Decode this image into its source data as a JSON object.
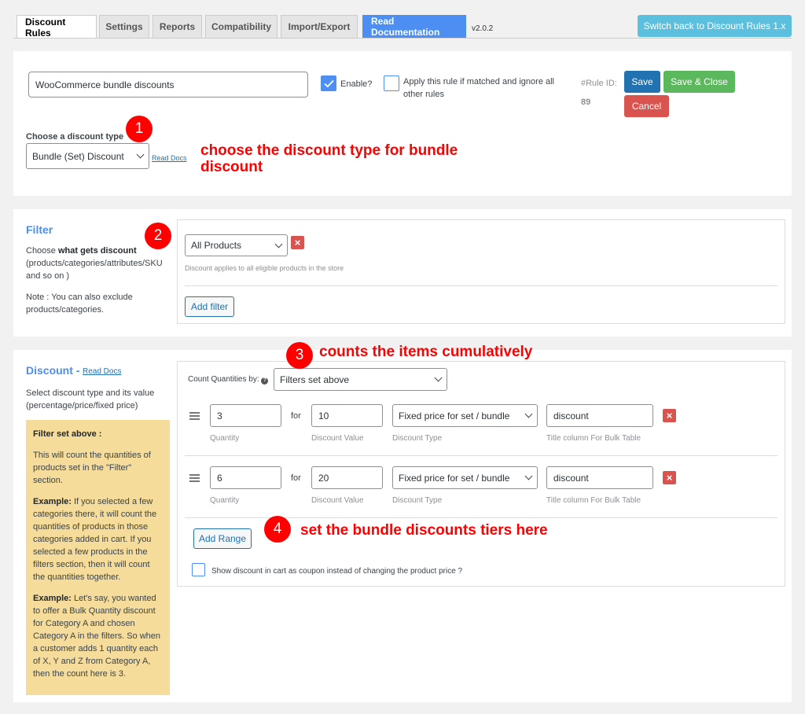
{
  "tabs": [
    {
      "label": "Discount Rules",
      "active": true
    },
    {
      "label": "Settings"
    },
    {
      "label": "Reports"
    },
    {
      "label": "Compatibility"
    },
    {
      "label": "Import/Export"
    },
    {
      "label": "Read Documentation"
    }
  ],
  "version": "v2.0.2",
  "switch_label": "Switch back to Discount Rules 1.x",
  "rule": {
    "name": "WooCommerce bundle discounts",
    "enable_label": "Enable?",
    "apply_label": "Apply this rule if matched and ignore all other rules",
    "rule_id_label": "#Rule ID:",
    "rule_id": "89",
    "save": "Save",
    "save_close": "Save & Close",
    "cancel": "Cancel",
    "discount_type_label": "Choose a discount type",
    "discount_type_value": "Bundle (Set) Discount",
    "read_docs": "Read Docs"
  },
  "annotations": {
    "n1": "1",
    "a1": "choose the discount type for bundle discount",
    "n2": "2",
    "n3": "3",
    "a3": "counts the items cumulatively",
    "n4": "4",
    "a4": "set the bundle discounts tiers here"
  },
  "filter": {
    "title": "Filter",
    "desc_prefix": "Choose ",
    "desc_bold": "what gets discount",
    "desc_suffix": "(products/categories/attributes/SKU and so on )",
    "note": "Note : You can also exclude products/categories.",
    "select_value": "All Products",
    "help": "Discount applies to all eligible products in the store",
    "add_filter": "Add filter"
  },
  "discount": {
    "title": "Discount",
    "dash": " - ",
    "read_docs": "Read Docs",
    "desc": "Select discount type and its value (percentage/price/fixed price)",
    "count_label": "Count Quantities by:",
    "count_value": "Filters set above",
    "for_label": "for",
    "labels": {
      "quantity": "Quantity",
      "value": "Discount Value",
      "type": "Discount Type",
      "title": "Title column For Bulk Table"
    },
    "ranges": [
      {
        "quantity": "3",
        "value": "10",
        "type": "Fixed price for set / bundle",
        "title": "discount"
      },
      {
        "quantity": "6",
        "value": "20",
        "type": "Fixed price for set / bundle",
        "title": "discount"
      }
    ],
    "add_range": "Add Range",
    "coupon_label": "Show discount in cart as coupon instead of changing the product price ?"
  },
  "note": {
    "heading": "Filter set above :",
    "p1": "This will count the quantities of products set in the \"Filter\" section.",
    "ex1_label": "Example:",
    "ex1": " If you selected a few categories there, it will count the quantities of products in those categories added in cart. If you selected a few products in the filters section, then it will count the quantities together.",
    "ex2_label": "Example:",
    "ex2": " Let's say, you wanted to offer a Bulk Quantity discount for Category A and chosen Category A in the filters. So when a customer adds 1 quantity each of X, Y and Z from Category A, then the count here is 3."
  }
}
